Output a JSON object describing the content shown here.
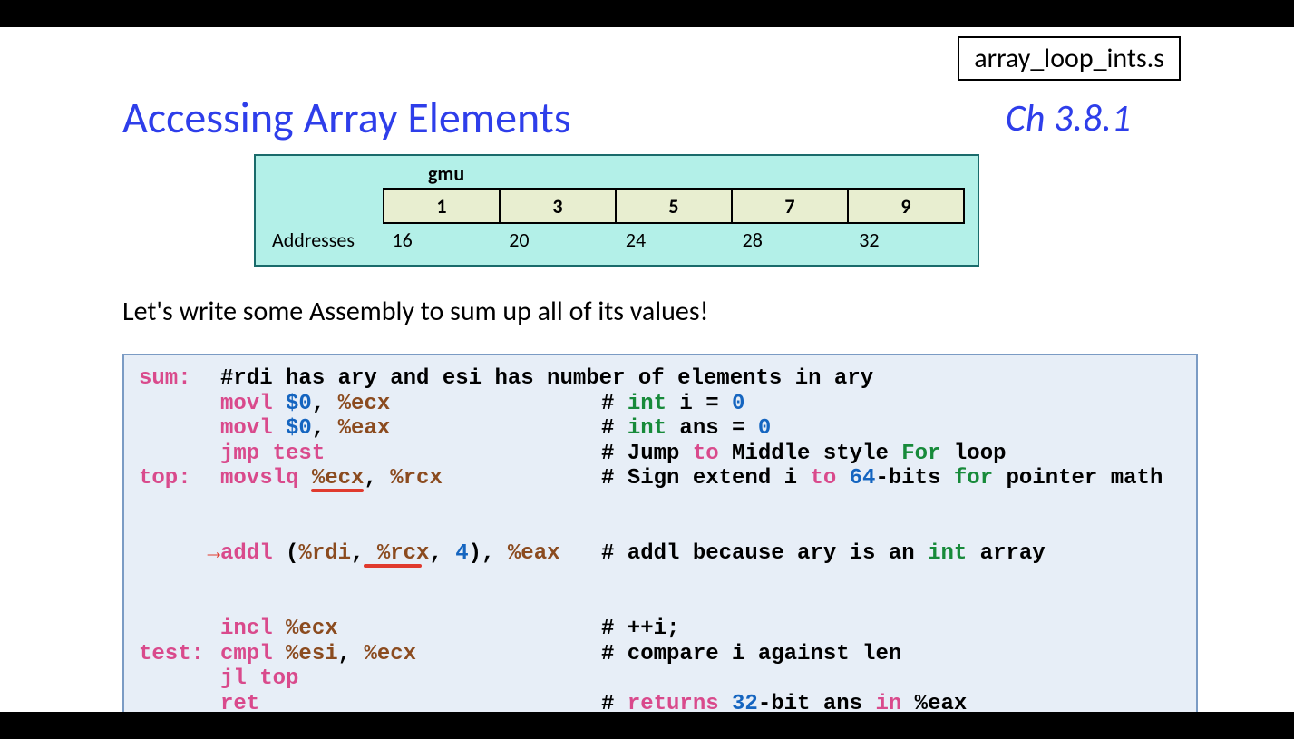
{
  "filename": "array_loop_ints.s",
  "title": "Accessing Array Elements",
  "chapter": "Ch 3.8.1",
  "array": {
    "name": "gmu",
    "values": [
      "1",
      "3",
      "5",
      "7",
      "9"
    ],
    "addr_label": "Addresses",
    "addresses": [
      "16",
      "20",
      "24",
      "28",
      "32"
    ]
  },
  "subtitle": "Let's write some Assembly to sum up all of its values!",
  "code": {
    "labels": {
      "sum": "sum:",
      "top": "top:",
      "test": "test:"
    },
    "l1_comment": "#rdi has ary and esi has number of elements in ary",
    "l2_op": "movl",
    "l2_arg1": "$0",
    "l2_sep": ", ",
    "l2_arg2": "%ecx",
    "l2_cmt_pre": "# ",
    "l2_kw": "int",
    "l2_rest": " i = ",
    "l2_zero": "0",
    "l3_op": "movl",
    "l3_arg1": "$0",
    "l3_sep": ", ",
    "l3_arg2": "%eax",
    "l3_cmt_pre": "# ",
    "l3_kw": "int",
    "l3_rest": " ans = ",
    "l3_zero": "0",
    "l4_op": "jmp",
    "l4_arg": " test",
    "l4_cmt_pre": "# Jump ",
    "l4_to": "to",
    "l4_mid": " Middle style ",
    "l4_for": "For",
    "l4_loop": " loop",
    "l5_op": "movslq",
    "l5_arg1": " %ecx",
    "l5_sep": ", ",
    "l5_arg2": "%rcx",
    "l5_cmt_pre": "# Sign extend i ",
    "l5_to": "to ",
    "l5_num": "64",
    "l5_rest1": "-bits ",
    "l5_for": "for",
    "l5_rest2": " pointer math",
    "l6_arrow": "→",
    "l6_op": "addl",
    "l6_p1": " (",
    "l6_r1": "%rdi",
    "l6_c1": ", ",
    "l6_r2": "%rcx",
    "l6_c2": ", ",
    "l6_n": "4",
    "l6_p2": "), ",
    "l6_r3": "%eax",
    "l6_cmt_pre": "# addl because ary is an ",
    "l6_int": "int",
    "l6_rest": " array",
    "l7_op": "incl",
    "l7_arg": " %ecx",
    "l7_cmt": "# ++i;",
    "l8_op": "cmpl",
    "l8_arg1": " %esi",
    "l8_sep": ", ",
    "l8_arg2": "%ecx",
    "l8_cmt": "# compare i against len",
    "l9_op": "jl",
    "l9_arg": " top",
    "l10_op": "ret",
    "l10_cmt_pre": "# ",
    "l10_ret": "returns ",
    "l10_num": "32",
    "l10_rest1": "-bit ans ",
    "l10_in": "in",
    "l10_rest2": " %eax"
  }
}
